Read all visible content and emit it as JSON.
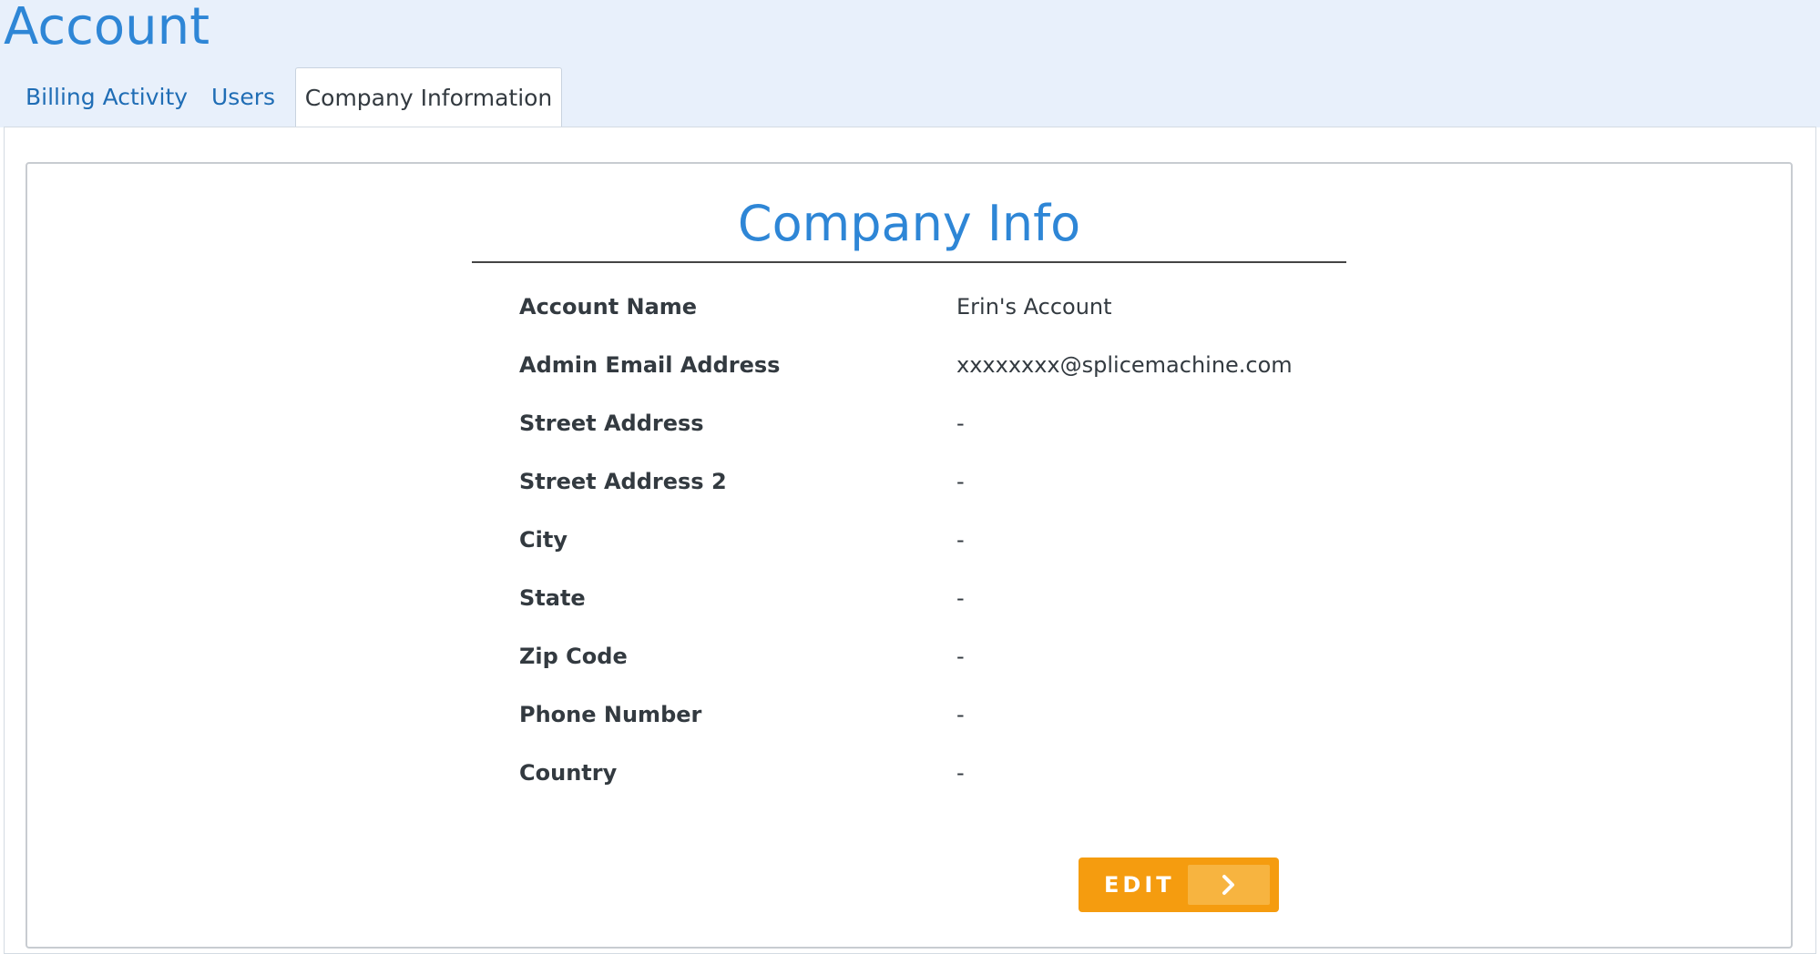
{
  "header": {
    "title": "Account"
  },
  "tabs": [
    {
      "label": "Billing Activity",
      "active": false
    },
    {
      "label": "Users",
      "active": false
    },
    {
      "label": "Company Information",
      "active": true
    }
  ],
  "card": {
    "title": "Company Info",
    "rows": [
      {
        "label": "Account Name",
        "value": "Erin's Account"
      },
      {
        "label": "Admin Email Address",
        "value": "xxxxxxxx@splicemachine.com"
      },
      {
        "label": "Street Address",
        "value": "-"
      },
      {
        "label": "Street Address 2",
        "value": "-"
      },
      {
        "label": "City",
        "value": "-"
      },
      {
        "label": "State",
        "value": "-"
      },
      {
        "label": "Zip Code",
        "value": "-"
      },
      {
        "label": "Phone Number",
        "value": "-"
      },
      {
        "label": "Country",
        "value": "-"
      }
    ],
    "edit_label": "EDIT",
    "edit_icon": "chevron-right-icon"
  },
  "colors": {
    "accent": "#2e86d6",
    "header_bg": "#e8f0fb",
    "edit_button": "#f59c0f"
  }
}
